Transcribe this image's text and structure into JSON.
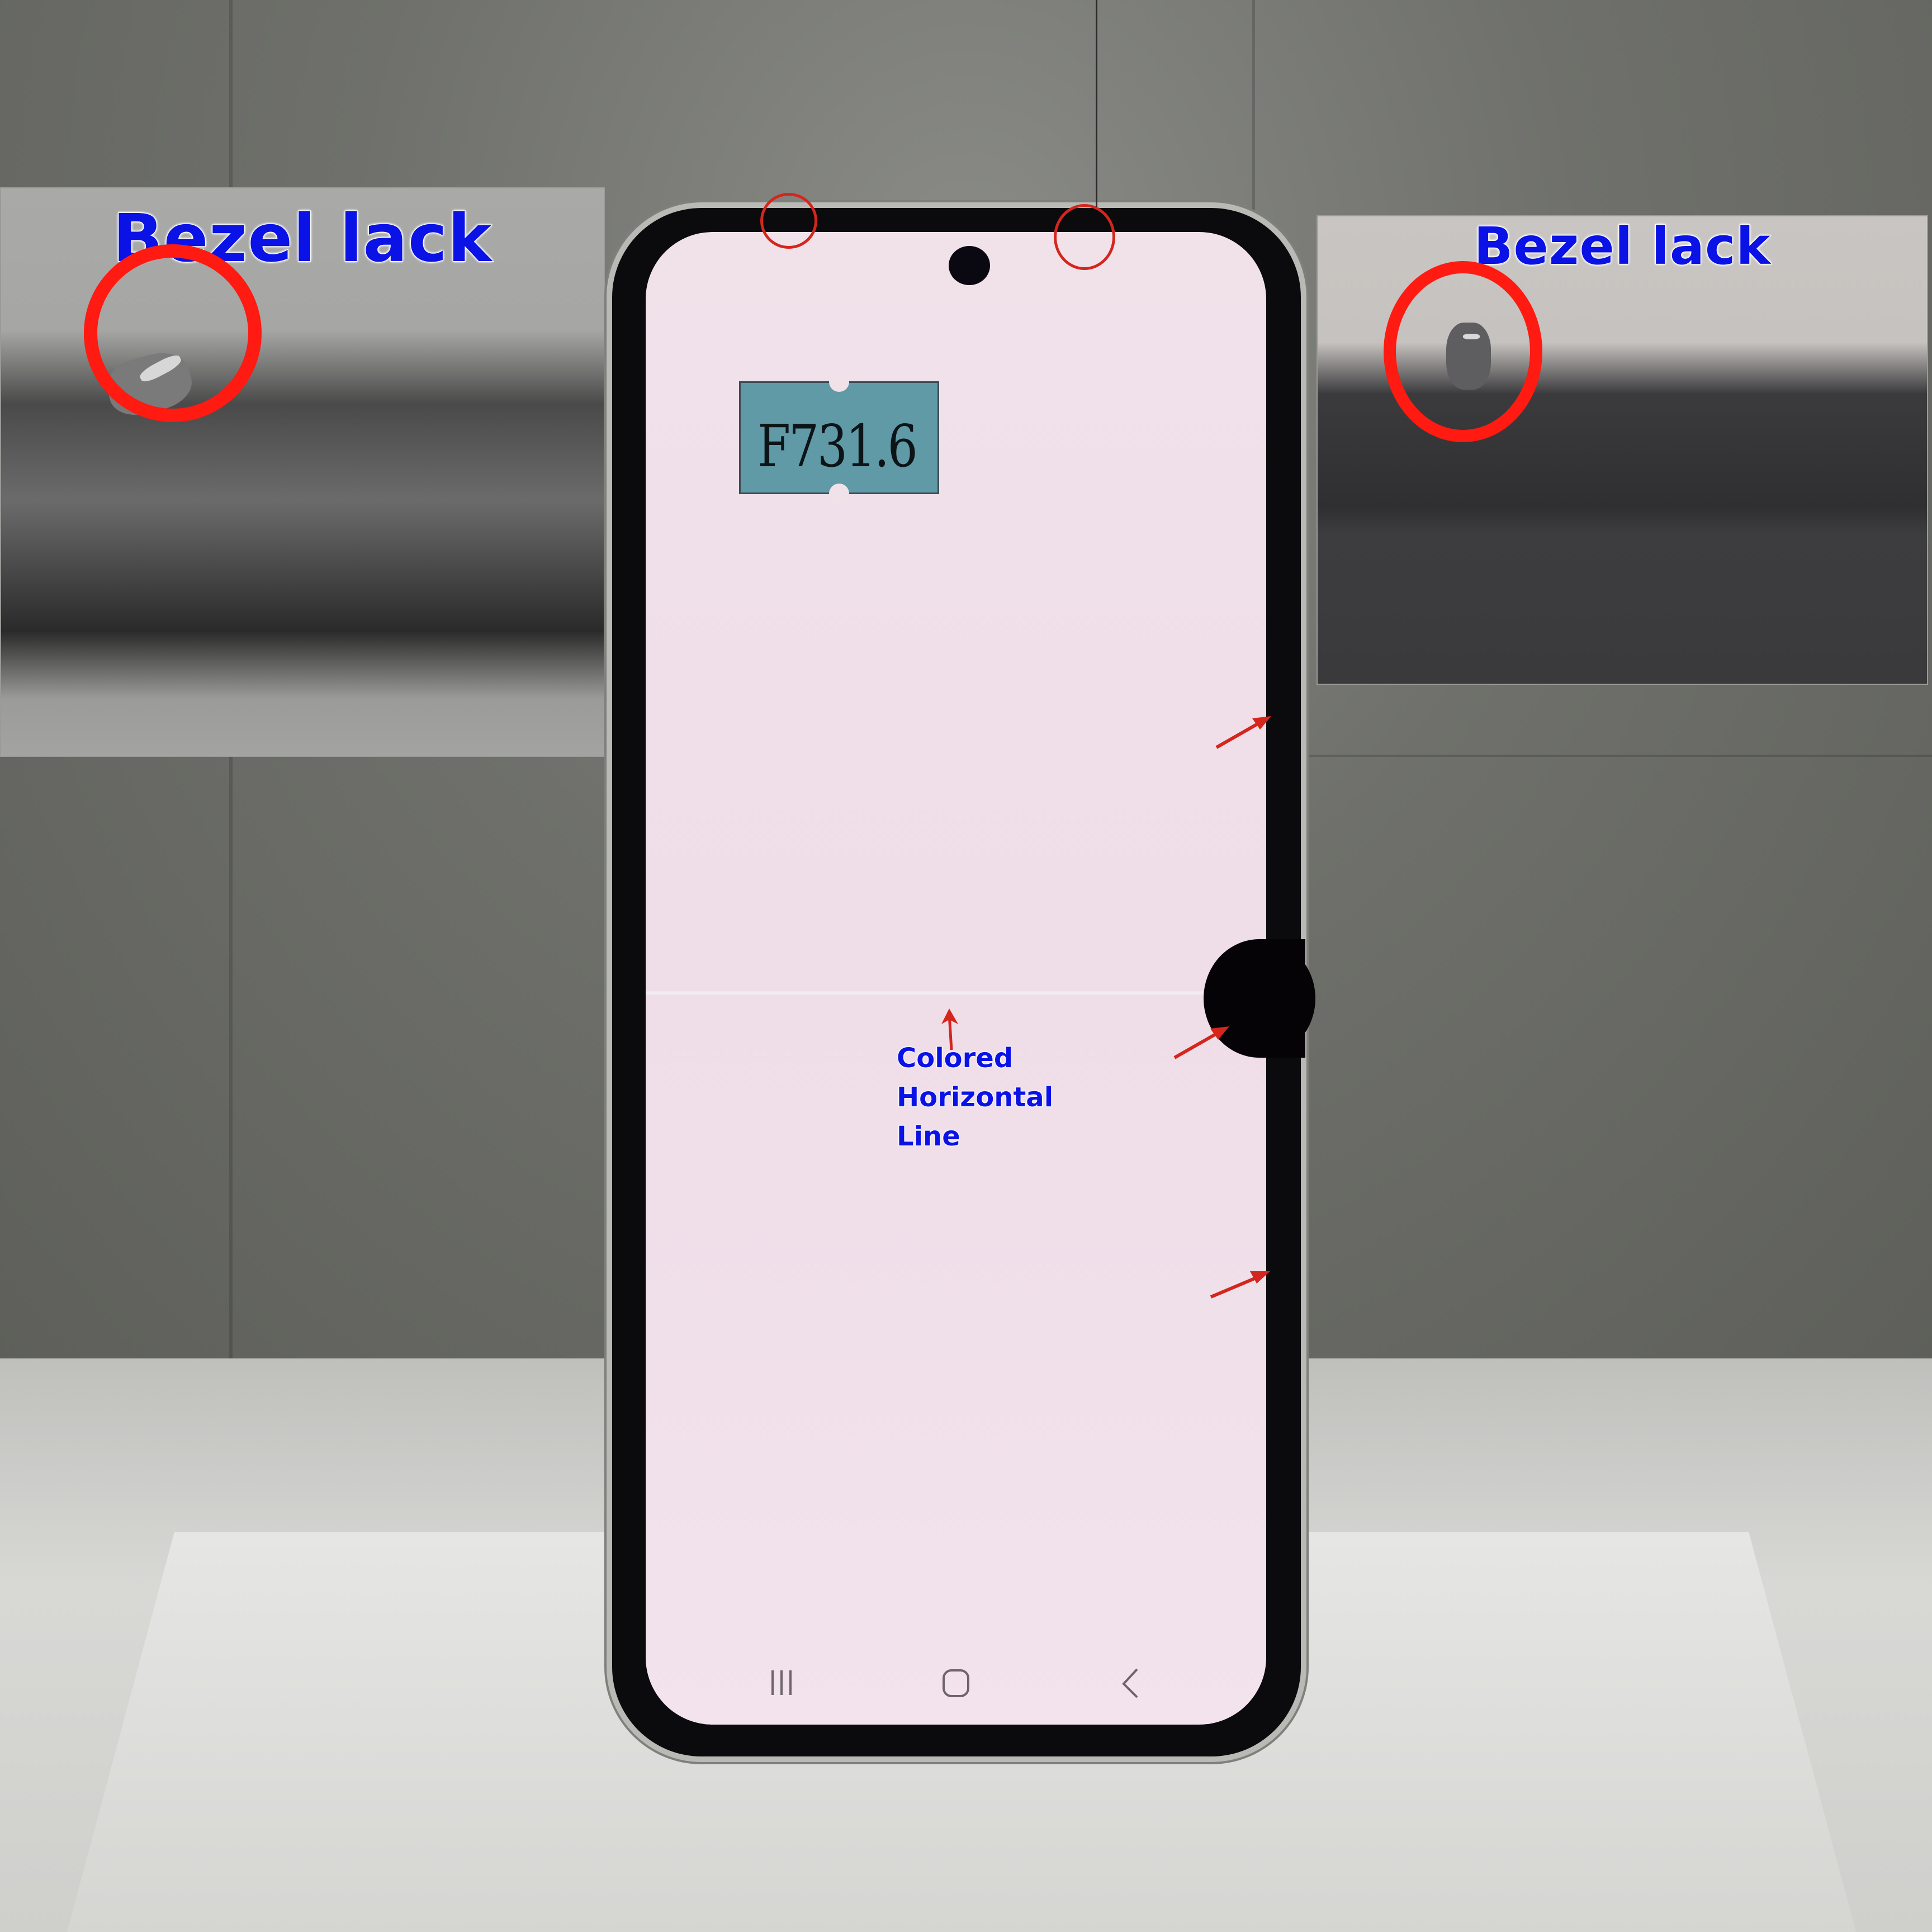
{
  "insets": {
    "left": {
      "title": "Bezel lack"
    },
    "right": {
      "title": "Bezel lack"
    }
  },
  "device": {
    "model_label": "F731.6",
    "screen_color": "#f1e2ea"
  },
  "annotation": {
    "lines": [
      "Colored",
      "Horizontal",
      "Line"
    ],
    "text_color": "#0a12e6",
    "marker_color": "#d4261d"
  },
  "nav_bar": {
    "icons": [
      "recent-apps-icon",
      "home-icon",
      "back-icon"
    ]
  }
}
